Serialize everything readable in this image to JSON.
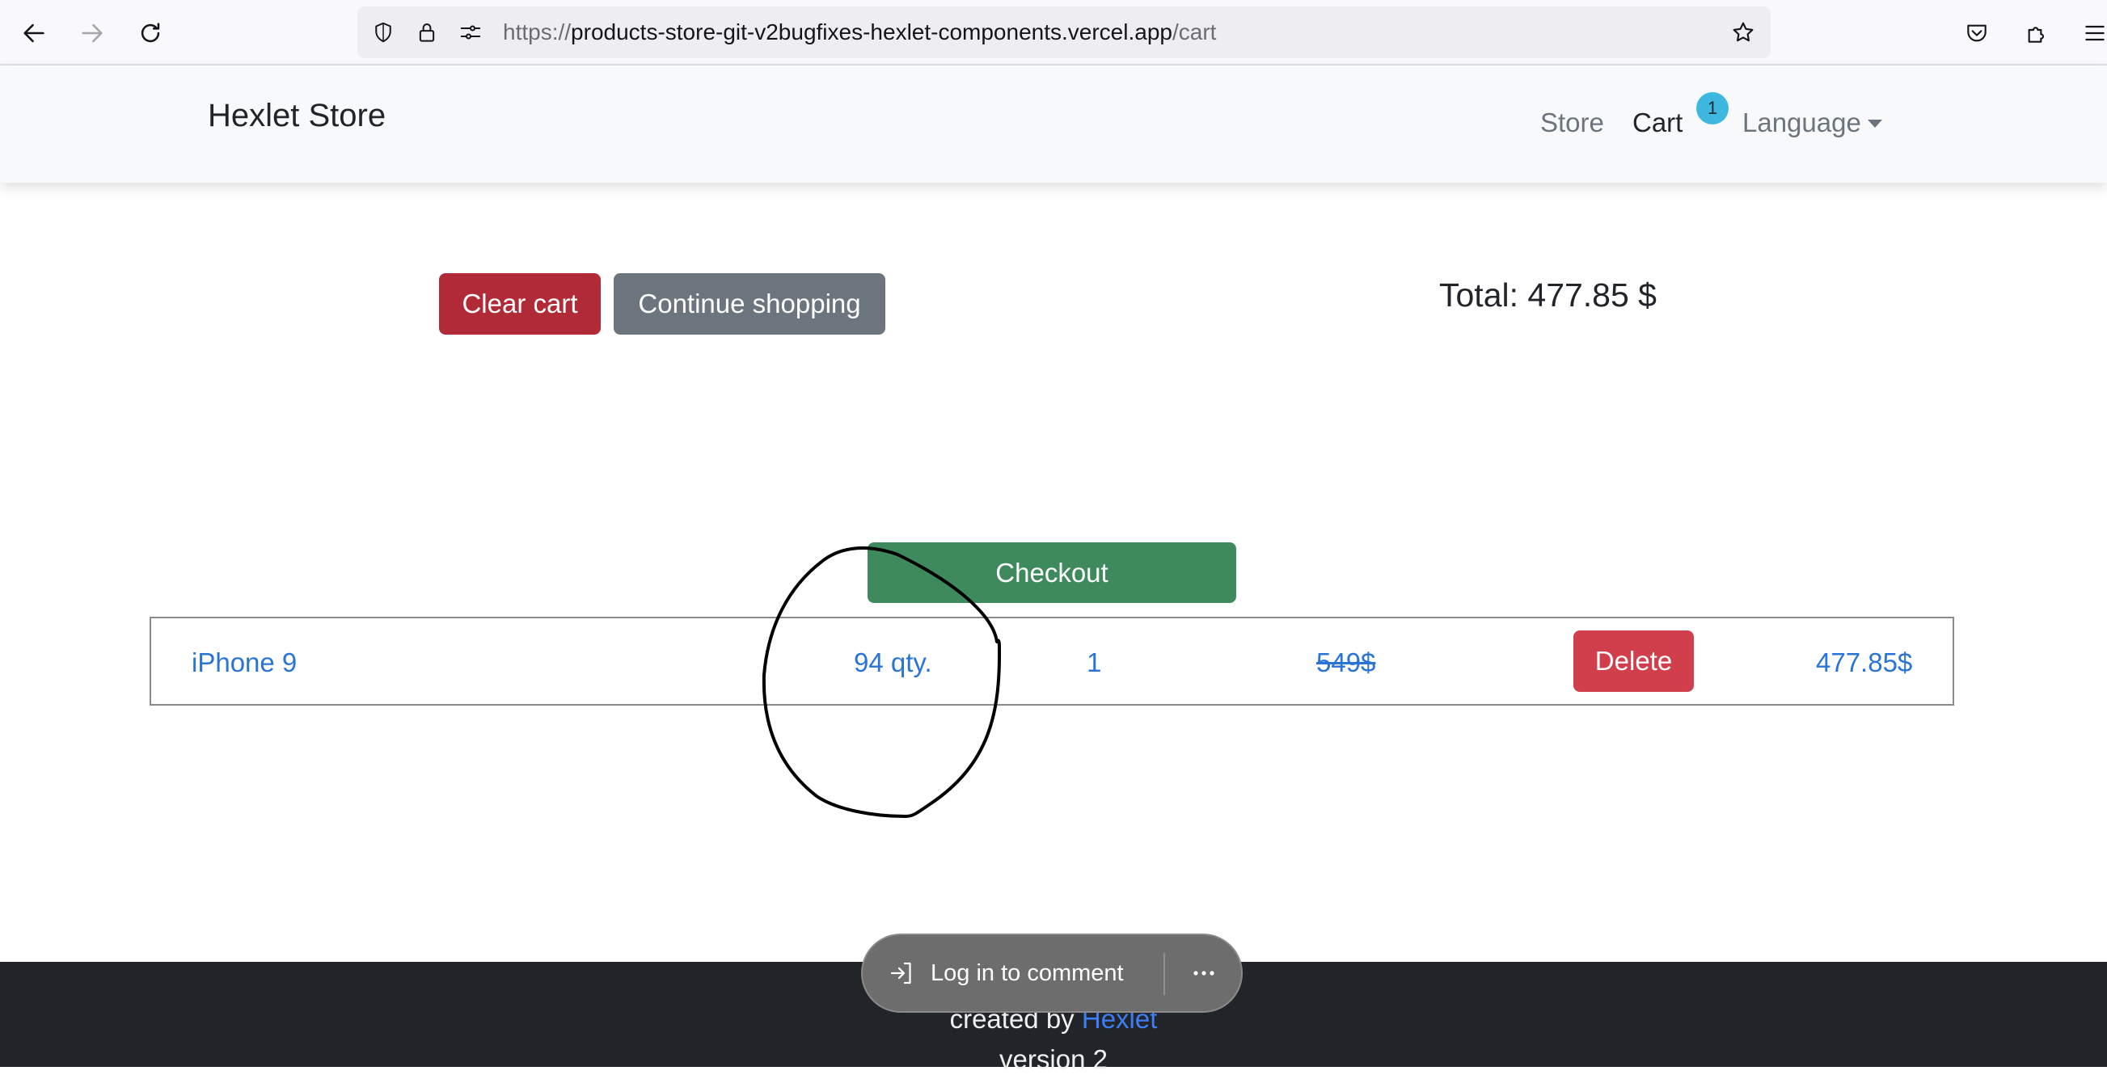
{
  "browser": {
    "url_scheme": "https://",
    "url_host": "products-store-git-v2bugfixes-hexlet-components.vercel.app",
    "url_path": "/cart"
  },
  "navbar": {
    "brand": "Hexlet Store",
    "links": {
      "store": "Store",
      "cart": "Cart",
      "cart_badge": "1",
      "language": "Language"
    }
  },
  "cart": {
    "clear_label": "Clear cart",
    "continue_label": "Continue shopping",
    "total": "Total: 477.85 $",
    "checkout_label": "Checkout",
    "item": {
      "name": "iPhone 9",
      "stock": "94 qty.",
      "quantity": "1",
      "old_price": "549$",
      "delete_label": "Delete",
      "price": "477.85$"
    }
  },
  "footer": {
    "created_by": "created by ",
    "link": "Hexlet",
    "version": "version 2"
  },
  "comment": {
    "login_label": "Log in to comment",
    "more_icon": "more-horizontal-icon"
  },
  "colors": {
    "danger": "#b02a37",
    "secondary": "#6c757d",
    "success": "#3f8a5c",
    "link": "#2a74d6",
    "badge": "#3fb8df",
    "footer_bg": "#212529"
  }
}
